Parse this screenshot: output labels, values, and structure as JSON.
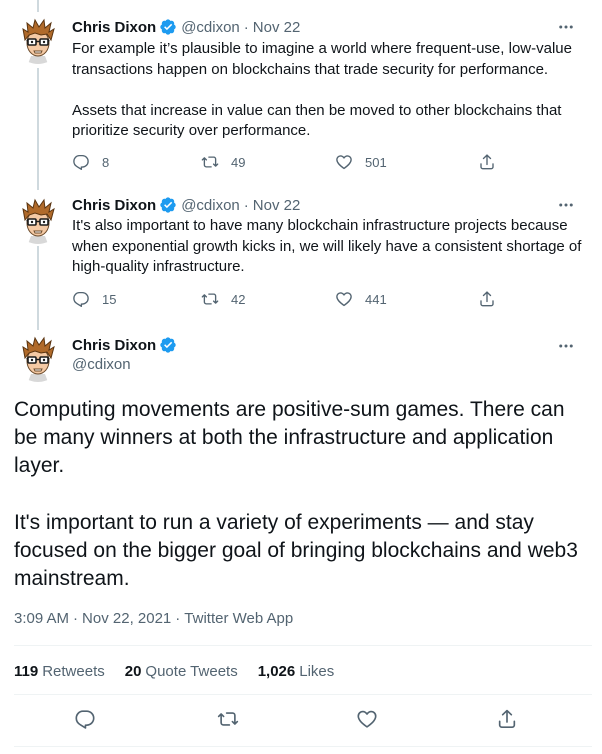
{
  "colors": {
    "text": "#0f1419",
    "secondary": "#536471",
    "verified": "#1d9bf0",
    "thread_line": "#cfd9de",
    "divider": "#eff3f4"
  },
  "tweets": [
    {
      "author": "Chris Dixon",
      "handle": "@cdixon",
      "separator": "·",
      "date": "Nov 22",
      "text": "For example it’s plausible to imagine a world where frequent-use, low-value transactions happen on blockchains that trade security for performance.\n\nAssets that increase in value can then be moved to other blockchains that prioritize security over performance.",
      "replies": "8",
      "retweets": "49",
      "likes": "501"
    },
    {
      "author": "Chris Dixon",
      "handle": "@cdixon",
      "separator": "·",
      "date": "Nov 22",
      "text": "It's also important to have many blockchain infrastructure projects because when exponential growth kicks in, we will likely have a consistent shortage of high-quality infrastructure.",
      "replies": "15",
      "retweets": "42",
      "likes": "441"
    }
  ],
  "main_tweet": {
    "author": "Chris Dixon",
    "handle": "@cdixon",
    "text": "Computing movements are positive-sum games. There can be many winners at both the infrastructure and application layer.\n\nIt's important to run a variety of experiments — and stay focused on the bigger goal of bringing blockchains and web3 mainstream.",
    "time": "3:09 AM",
    "meta_separator": "·",
    "date": "Nov 22, 2021",
    "source": "Twitter Web App",
    "retweets_count": "119",
    "retweets_label": "Retweets",
    "quote_count": "20",
    "quote_label": "Quote Tweets",
    "likes_count": "1,026",
    "likes_label": "Likes"
  },
  "icons": {
    "verified": "verified-badge-icon",
    "more": "more-horizontal-icon",
    "reply": "reply-icon",
    "retweet": "retweet-icon",
    "like": "heart-icon",
    "share": "share-icon"
  }
}
